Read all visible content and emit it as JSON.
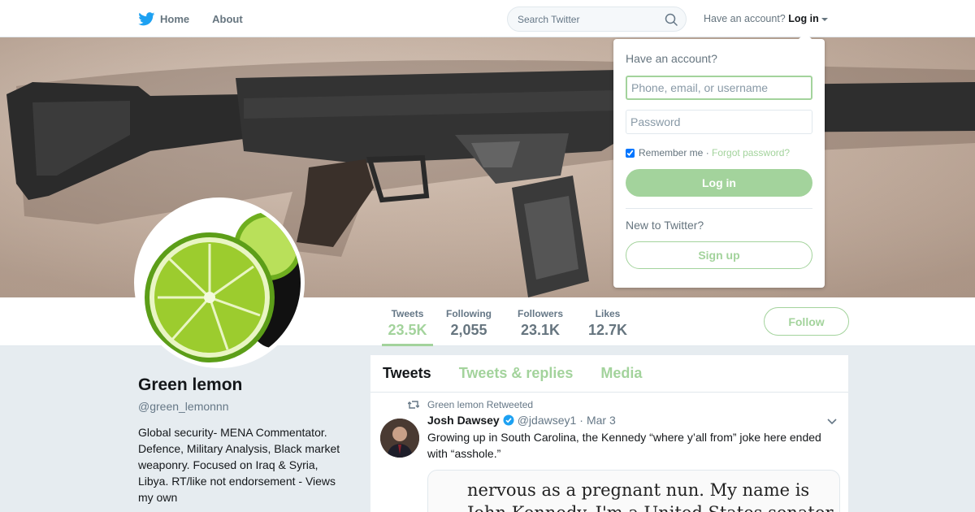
{
  "nav": {
    "home_label": "Home",
    "about_label": "About",
    "search_placeholder": "Search Twitter",
    "account_prompt": "Have an account?",
    "login_label": "Log in"
  },
  "profile": {
    "name": "Green lemon",
    "handle": "@green_lemonnn",
    "bio": "Global security- MENA Commentator. Defence, Military Analysis, Black market weaponry. Focused on Iraq & Syria, Libya. RT/like not endorsement - Views my own",
    "follow_label": "Follow",
    "stats": [
      {
        "label": "Tweets",
        "value": "23.5K"
      },
      {
        "label": "Following",
        "value": "2,055"
      },
      {
        "label": "Followers",
        "value": "23.1K"
      },
      {
        "label": "Likes",
        "value": "12.7K"
      }
    ]
  },
  "timeline": {
    "tabs": [
      {
        "label": "Tweets"
      },
      {
        "label": "Tweets & replies"
      },
      {
        "label": "Media"
      }
    ],
    "tweet": {
      "retweet_context": "Green lemon Retweeted",
      "author": "Josh Dawsey",
      "handle": "@jdawsey1",
      "separator": "·",
      "time": "Mar 3",
      "text": "Growing up in South Carolina, the Kennedy “where y’all from” joke here ended with “asshole.”",
      "media_lines": [
        "nervous as a pregnant nun. My name is",
        "John Kennedy. I'm a United States senator"
      ]
    }
  },
  "login_dropdown": {
    "title": "Have an account?",
    "username_placeholder": "Phone, email, or username",
    "password_placeholder": "Password",
    "remember_label": "Remember me",
    "separator": "·",
    "forgot_label": "Forgot password?",
    "login_button": "Log in",
    "new_prompt": "New to Twitter?",
    "signup_button": "Sign up"
  },
  "colors": {
    "accent": "#a3d39c",
    "twitter_blue": "#1da1f2",
    "text_secondary": "#657786"
  }
}
